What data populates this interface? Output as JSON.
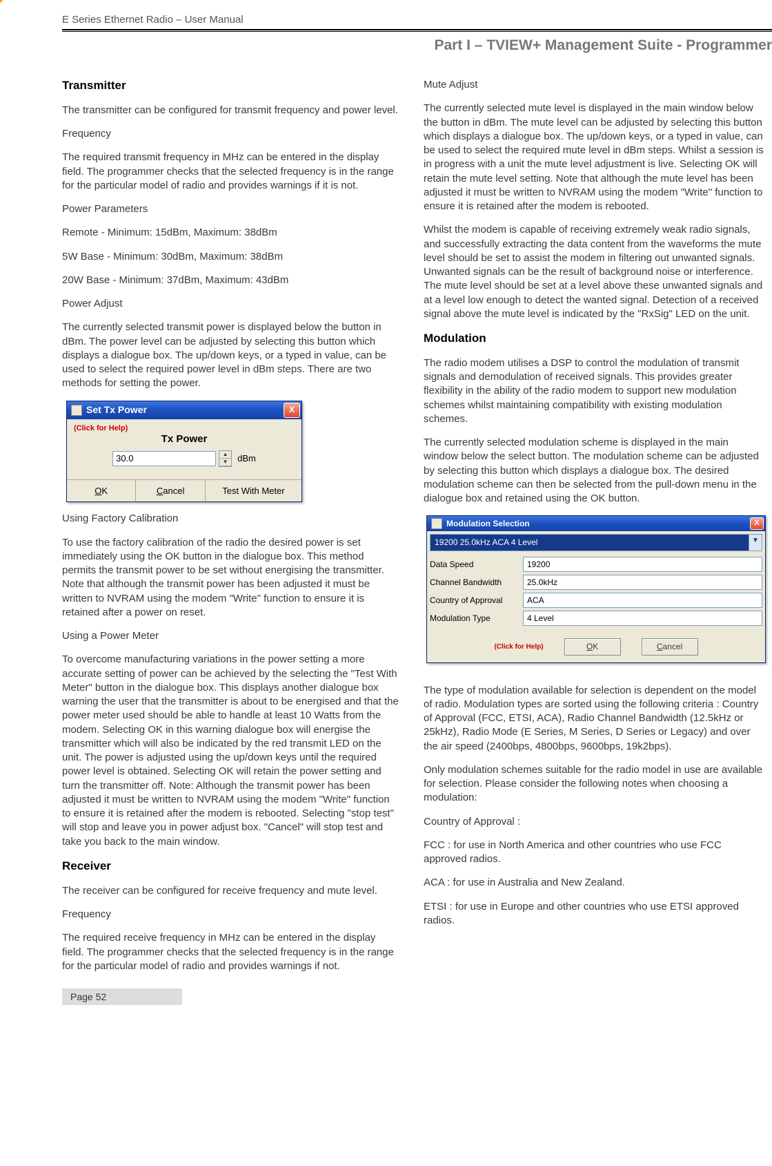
{
  "header": {
    "doc_title": "E Series Ethernet Radio – User Manual",
    "part_title": "Part I – TVIEW+ Management Suite - Programmer"
  },
  "footer": {
    "page": "Page 52"
  },
  "left": {
    "h_transmitter": "Transmitter",
    "tx_intro": "The transmitter can be configured for transmit frequency and power level.",
    "freq_head": "Frequency",
    "freq_body": "The required transmit frequency in MHz can be entered in the display field.  The programmer checks that the selected frequency is in the range for the particular model of radio and provides warnings if it is not.",
    "pp_head": "Power Parameters",
    "pp_remote": "Remote -  Minimum: 15dBm, Maximum: 38dBm",
    "pp_5w": "5W Base - Minimum: 30dBm, Maximum: 38dBm",
    "pp_20w": "20W Base - Minimum: 37dBm, Maximum: 43dBm",
    "pa_head": "Power Adjust",
    "pa_body": "The currently selected transmit power is displayed below the button in dBm. The power level can be adjusted by selecting this button which displays a dialogue box. The up/down keys, or a typed in value, can be used to select the required power level in dBm steps. There are two methods for setting the power.",
    "ufc_head": "Using Factory Calibration",
    "ufc_body": "To use the factory calibration of the radio the desired power is set immediately using the OK button in the dialogue box. This method permits the transmit power to be set without energising the transmitter. Note that although the transmit power has been adjusted it must be written to NVRAM using the modem \"Write\" function to ensure it is retained after a power on reset.",
    "upm_head": "Using a Power Meter",
    "upm_body": "To overcome manufacturing variations in the power setting a more accurate setting of power can be achieved by the selecting the \"Test With Meter\" button in the dialogue box. This displays another dialogue box warning the user that the transmitter is about to be energised and that the power meter used should be able to handle at least 10 Watts from the modem. Selecting OK in this warning dialogue box will energise the transmitter which will also be indicated by the red transmit LED on the unit. The power is adjusted using the up/down keys until the required power level is obtained. Selecting OK will retain the power setting and turn the transmitter off. Note: Although the transmit power has been adjusted it must be written to NVRAM using the modem \"Write\" function to ensure it is retained after the modem is rebooted. Selecting \"stop test\" will stop and leave you in power adjust box. \"Cancel\" will stop test and take you back to the main window.",
    "h_receiver": "Receiver",
    "rx_intro": "The receiver can be configured for receive frequency and mute level.",
    "rx_freq_head": "Frequency",
    "rx_freq_body": "The required receive frequency in MHz can be entered in the display field.  The programmer checks that the selected frequency is in the range for the particular model of radio and provides warnings if not."
  },
  "right": {
    "mute_head": "Mute Adjust",
    "mute_p1": "The currently selected mute level is displayed in the main window below the button in dBm. The mute level can be adjusted by selecting this button which displays a dialogue box. The up/down keys, or a typed in value, can be used to select the required mute level in dBm steps. Whilst a session is in progress with a unit the mute level adjustment is live. Selecting OK will retain the mute level setting. Note that although the mute level has been adjusted it must be written to NVRAM using the modem \"Write\" function to ensure it is retained after the modem is rebooted.",
    "mute_p2": "Whilst the modem is capable of receiving extremely weak radio signals, and successfully extracting the data content from the waveforms the mute level should be set to assist the modem in filtering out unwanted signals. Unwanted signals can be the result of background noise or interference. The mute level should be set at a level above these unwanted signals and at a level low enough to detect the wanted signal. Detection of a received signal above the mute level is indicated by the \"RxSig\" LED on the unit.",
    "h_modulation": "Modulation",
    "mod_p1": "The radio modem utilises a DSP to control the modulation of transmit signals and demodulation of received signals. This provides greater flexibility in the ability of the radio modem to support new modulation schemes whilst maintaining compatibility with existing modulation schemes.",
    "mod_p2": "The currently selected modulation scheme is displayed in the main window below the select button. The modulation scheme can be adjusted by selecting this button which displays a dialogue box. The desired modulation scheme can then be selected from the pull-down menu in the dialogue box and retained using the OK button.",
    "mod_p3": "The type of modulation available for selection is dependent on the model of radio. Modulation types are sorted using the following criteria : Country of Approval (FCC, ETSI, ACA), Radio Channel Bandwidth (12.5kHz or 25kHz), Radio Mode (E Series, M Series, D Series or Legacy) and over the air speed (2400bps, 4800bps, 9600bps, 19k2bps).",
    "mod_p4": "Only modulation schemes suitable for the radio model in use are available for selection. Please consider the following notes when choosing a modulation:",
    "coa_head": "Country of Approval :",
    "coa_fcc": "FCC : for use in North America and other countries who use FCC approved radios.",
    "coa_aca": "ACA : for use in Australia and New Zealand.",
    "coa_etsi": "ETSI : for use in Europe and other countries who use ETSI approved radios."
  },
  "dlg_tx": {
    "title": "Set Tx Power",
    "help": "(Click for Help)",
    "label": "Tx Power",
    "value": "30.0",
    "unit": "dBm",
    "ok": "OK",
    "cancel": "Cancel",
    "test": "Test With Meter"
  },
  "dlg_mod": {
    "title": "Modulation Selection",
    "selected": "19200 25.0kHz ACA 4 Level",
    "rows": {
      "speed_l": "Data Speed",
      "speed_v": "19200",
      "bw_l": "Channel Bandwidth",
      "bw_v": "25.0kHz",
      "coa_l": "Country of Approval",
      "coa_v": "ACA",
      "mt_l": "Modulation Type",
      "mt_v": "4 Level"
    },
    "help": "(Click for Help)",
    "ok": "OK",
    "cancel": "Cancel"
  }
}
